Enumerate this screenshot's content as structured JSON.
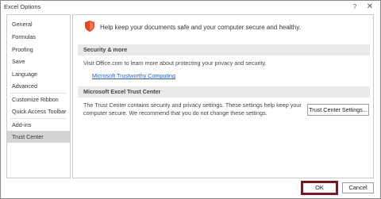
{
  "window": {
    "title": "Excel Options"
  },
  "titlebar": {
    "help_symbol": "?",
    "close_symbol": "✕"
  },
  "sidebar": {
    "items": [
      {
        "label": "General"
      },
      {
        "label": "Formulas"
      },
      {
        "label": "Proofing"
      },
      {
        "label": "Save"
      },
      {
        "label": "Language"
      },
      {
        "label": "Advanced"
      },
      {
        "label": "Customize Ribbon"
      },
      {
        "label": "Quick Access Toolbar"
      },
      {
        "label": "Add-ins"
      },
      {
        "label": "Trust Center"
      }
    ],
    "selected": "Trust Center"
  },
  "content": {
    "headline": "Help keep your documents safe and your computer secure and healthy.",
    "security": {
      "title": "Security & more",
      "text": "Visit Office.com to learn more about protecting your privacy and security.",
      "link": "Microsoft Trustworthy Computing"
    },
    "trust_center": {
      "title": "Microsoft Excel Trust Center",
      "text_line1": "The Trust Center contains security and privacy settings. These settings help keep your",
      "text_line2": "computer secure. We recommend that you do not change these settings.",
      "button_label": "Trust Center Settings..."
    }
  },
  "footer": {
    "ok_label": "OK",
    "cancel_label": "Cancel"
  },
  "icons": {
    "shield": "shield-icon",
    "help": "help-icon",
    "close": "close-icon"
  },
  "colors": {
    "shield": "#e0471e",
    "selected_item": "#d4d4d4",
    "ok_highlight": "#7e1520",
    "link": "#2a5fa8"
  }
}
